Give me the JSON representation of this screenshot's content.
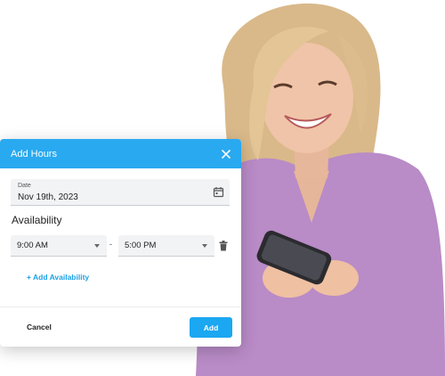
{
  "modal": {
    "title": "Add Hours",
    "close_icon": "close-icon",
    "date": {
      "label": "Date",
      "value": "Nov 19th, 2023",
      "icon": "calendar-icon"
    },
    "availability_heading": "Availability",
    "slot": {
      "start": "9:00 AM",
      "separator": "-",
      "end": "5:00 PM",
      "delete_icon": "trash-icon"
    },
    "add_availability_label": "+ Add Availability",
    "cancel_label": "Cancel",
    "add_label": "Add"
  },
  "colors": {
    "header": "#29a9f0",
    "accent": "#1ba7f1"
  }
}
